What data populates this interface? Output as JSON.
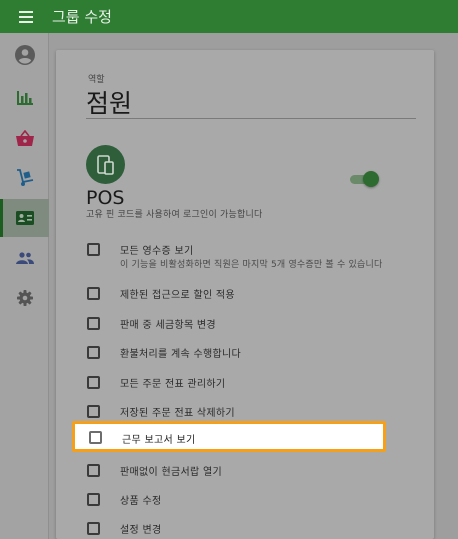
{
  "appbar": {
    "title": "그룹 수정",
    "menu_icon": "menu-icon",
    "color": "#2e7d32"
  },
  "sidebar": {
    "items": [
      {
        "icon": "account-circle-icon",
        "active": false
      },
      {
        "icon": "bar-chart-icon",
        "active": false
      },
      {
        "icon": "basket-icon",
        "active": false
      },
      {
        "icon": "dolly-icon",
        "active": false
      },
      {
        "icon": "badge-icon",
        "active": true
      },
      {
        "icon": "people-icon",
        "active": false
      },
      {
        "icon": "gear-icon",
        "active": false
      }
    ]
  },
  "form": {
    "role_label": "역할",
    "role_name": "점원"
  },
  "pos": {
    "icon": "devices-icon",
    "title": "POS",
    "description": "고유 핀 코드를 사용하여 로그인이 가능합니다",
    "enabled": true
  },
  "permissions": [
    {
      "label": "모든 영수증 보기",
      "sub": "이 기능을 비활성화하면 직원은 마지막 5개 영수증만 볼 수 있습니다",
      "checked": false
    },
    {
      "label": "제한된 접근으로 할인 적용",
      "checked": false
    },
    {
      "label": "판매 중 세금항목 변경",
      "checked": false
    },
    {
      "label": "환불처리를 계속 수행합니다",
      "checked": false
    },
    {
      "label": "모든 주문 전표 관리하기",
      "checked": false
    },
    {
      "label": "저장된 주문 전표 삭제하기",
      "checked": false
    },
    {
      "label": "근무 보고서 보기",
      "checked": false,
      "highlighted": true
    },
    {
      "label": "판매없이 현금서랍 열기",
      "checked": false
    },
    {
      "label": "상품 수정",
      "checked": false
    },
    {
      "label": "설정 변경",
      "checked": false
    }
  ],
  "colors": {
    "highlight": "#f5a01a",
    "accent": "#2e7d32"
  }
}
